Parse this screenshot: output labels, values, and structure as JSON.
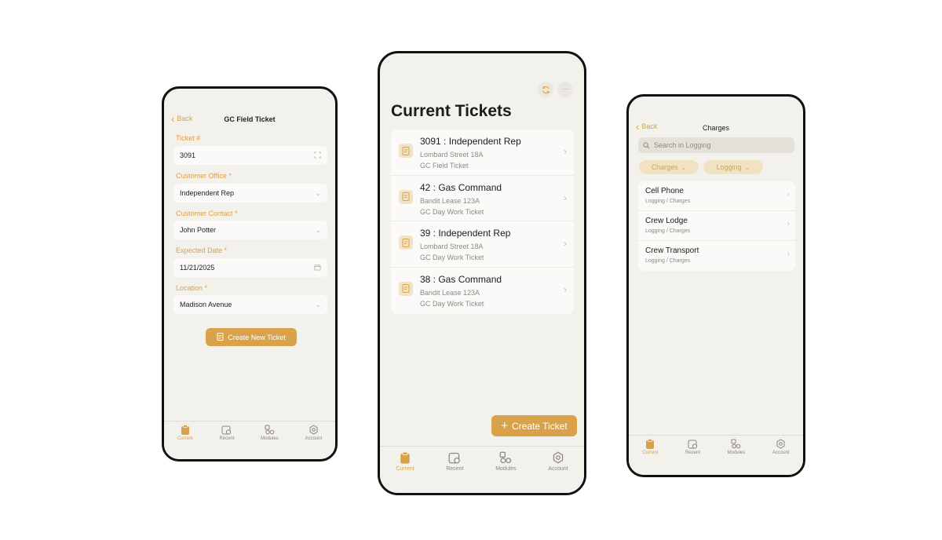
{
  "left_screen": {
    "back_label": "Back",
    "title": "GC Field Ticket",
    "fields": [
      {
        "label": "Ticket #",
        "value": "3091",
        "trail_icon": "scan-icon"
      },
      {
        "label": "Customer Office *",
        "value": "Independent Rep",
        "trail_icon": "chevron-down-icon"
      },
      {
        "label": "Customer Contact *",
        "value": "John Potter",
        "trail_icon": "chevron-down-icon"
      },
      {
        "label": "Expected Date *",
        "value": "11/21/2025",
        "trail_icon": "calendar-icon"
      },
      {
        "label": "Location *",
        "value": "Madison Avenue",
        "trail_icon": "chevron-down-icon"
      }
    ],
    "create_button": "Create New Ticket"
  },
  "middle_screen": {
    "title": "Current Tickets",
    "refresh_icon": "refresh-icon",
    "more_icon": "more-icon",
    "tickets": [
      {
        "title": "3091 : Independent Rep",
        "location": "Lombard Street 18A",
        "type": "GC Field Ticket"
      },
      {
        "title": "42 : Gas Command",
        "location": "Bandit Lease 123A",
        "type": "GC Day Work Ticket"
      },
      {
        "title": "39 : Independent Rep",
        "location": "Lombard Street 18A",
        "type": "GC Day Work Ticket"
      },
      {
        "title": "38 : Gas Command",
        "location": "Bandit Lease 123A",
        "type": "GC Day Work Ticket"
      }
    ],
    "create_button": "Create Ticket"
  },
  "right_screen": {
    "back_label": "Back",
    "title": "Charges",
    "search_placeholder": "Search in Logging",
    "chips": [
      "Charges",
      "Logging"
    ],
    "items": [
      {
        "title": "Cell Phone",
        "path": "Logging / Charges"
      },
      {
        "title": "Crew Lodge",
        "path": "Logging / Charges"
      },
      {
        "title": "Crew Transport",
        "path": "Logging / Charges"
      }
    ]
  },
  "tabs": [
    {
      "label": "Current",
      "icon": "clipboard-icon",
      "active": true
    },
    {
      "label": "Recent",
      "icon": "recent-icon",
      "active": false
    },
    {
      "label": "Modules",
      "icon": "modules-icon",
      "active": false
    },
    {
      "label": "Account",
      "icon": "gear-icon",
      "active": false
    }
  ],
  "colors": {
    "accent": "#d9a24a",
    "background": "#f3f1ec",
    "card": "#fbfaf8"
  }
}
